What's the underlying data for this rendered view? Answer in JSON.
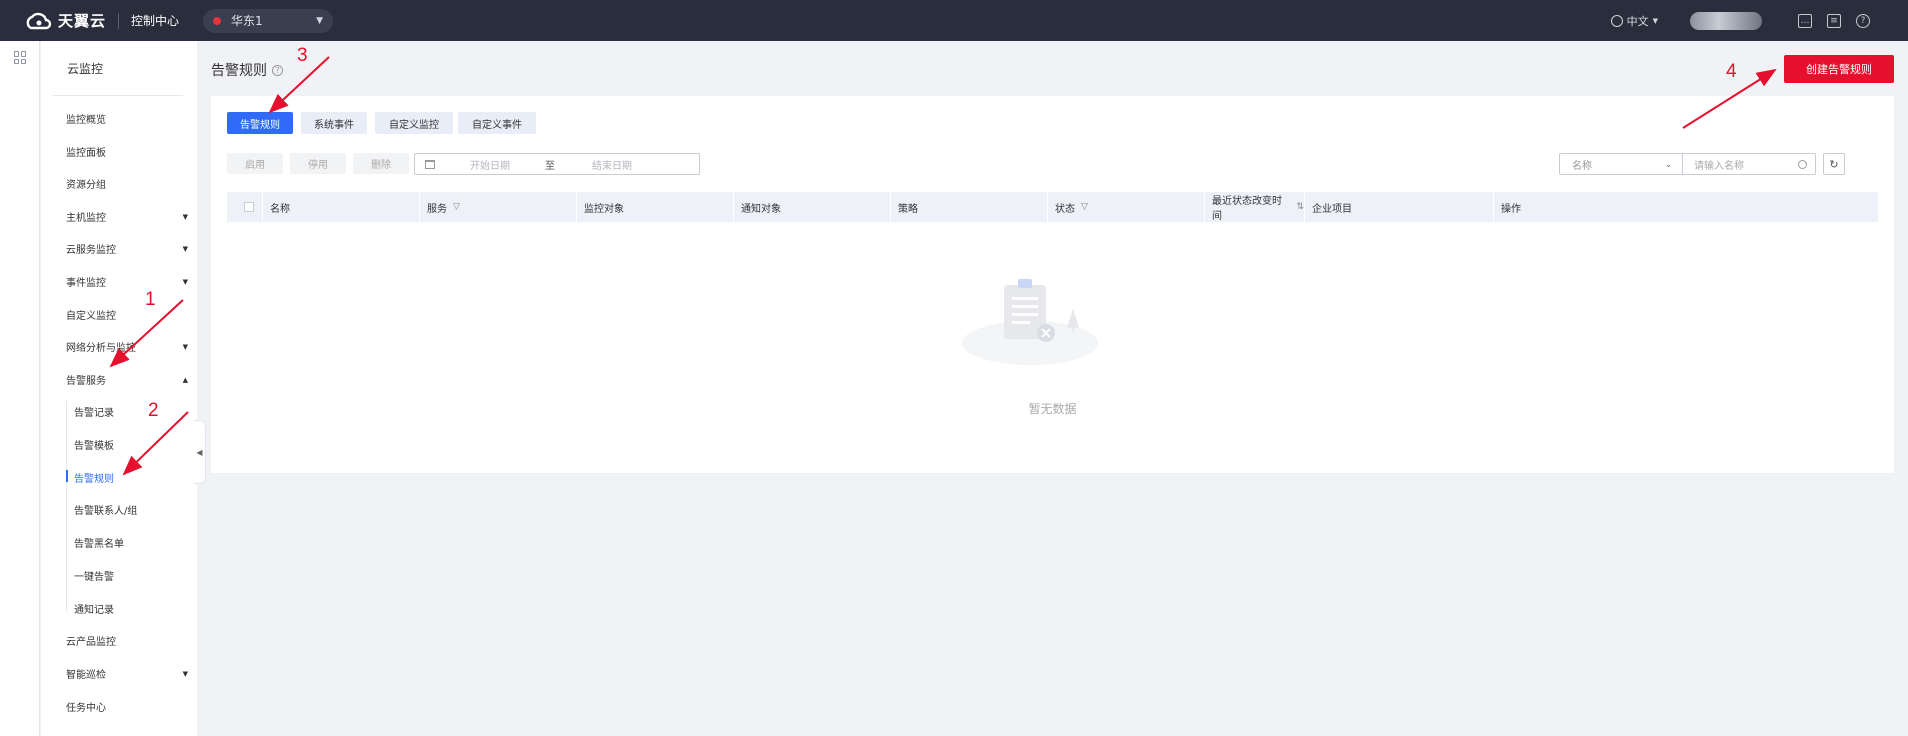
{
  "topbar": {
    "brand": "天翼云",
    "console_label": "控制中心",
    "region": "华东1",
    "language": "中文"
  },
  "sidebar": {
    "title": "云监控",
    "items": [
      {
        "label": "监控概览",
        "arrow": ""
      },
      {
        "label": "监控面板",
        "arrow": ""
      },
      {
        "label": "资源分组",
        "arrow": ""
      },
      {
        "label": "主机监控",
        "arrow": "▼"
      },
      {
        "label": "云服务监控",
        "arrow": "▼"
      },
      {
        "label": "事件监控",
        "arrow": "▼"
      },
      {
        "label": "自定义监控",
        "arrow": ""
      },
      {
        "label": "网络分析与监控",
        "arrow": "▼"
      },
      {
        "label": "告警服务",
        "arrow": "▲"
      }
    ],
    "sub_items": [
      "告警记录",
      "告警模板",
      "告警规则",
      "告警联系人/组",
      "告警黑名单",
      "一键告警",
      "通知记录"
    ],
    "bottom_items": [
      {
        "label": "云产品监控",
        "arrow": ""
      },
      {
        "label": "智能巡检",
        "arrow": "▼"
      },
      {
        "label": "任务中心",
        "arrow": ""
      }
    ]
  },
  "page": {
    "title": "告警规则",
    "create_button": "创建告警规则"
  },
  "tabs": [
    "告警规则",
    "系统事件",
    "自定义监控",
    "自定义事件"
  ],
  "actions": [
    "启用",
    "停用",
    "删除"
  ],
  "date_range": {
    "start_placeholder": "开始日期",
    "separator": "至",
    "end_placeholder": "结束日期"
  },
  "search": {
    "field": "名称",
    "placeholder": "请输入名称"
  },
  "table": {
    "columns": [
      "名称",
      "服务",
      "监控对象",
      "通知对象",
      "策略",
      "状态",
      "最近状态改变时间",
      "企业项目",
      "操作"
    ],
    "empty_text": "暂无数据"
  },
  "annotations": [
    "1",
    "2",
    "3",
    "4"
  ],
  "colors": {
    "primary": "#2f6bf7",
    "danger": "#e60f2d",
    "topbar": "#2a2e3c",
    "annotation": "#e60f2d"
  }
}
